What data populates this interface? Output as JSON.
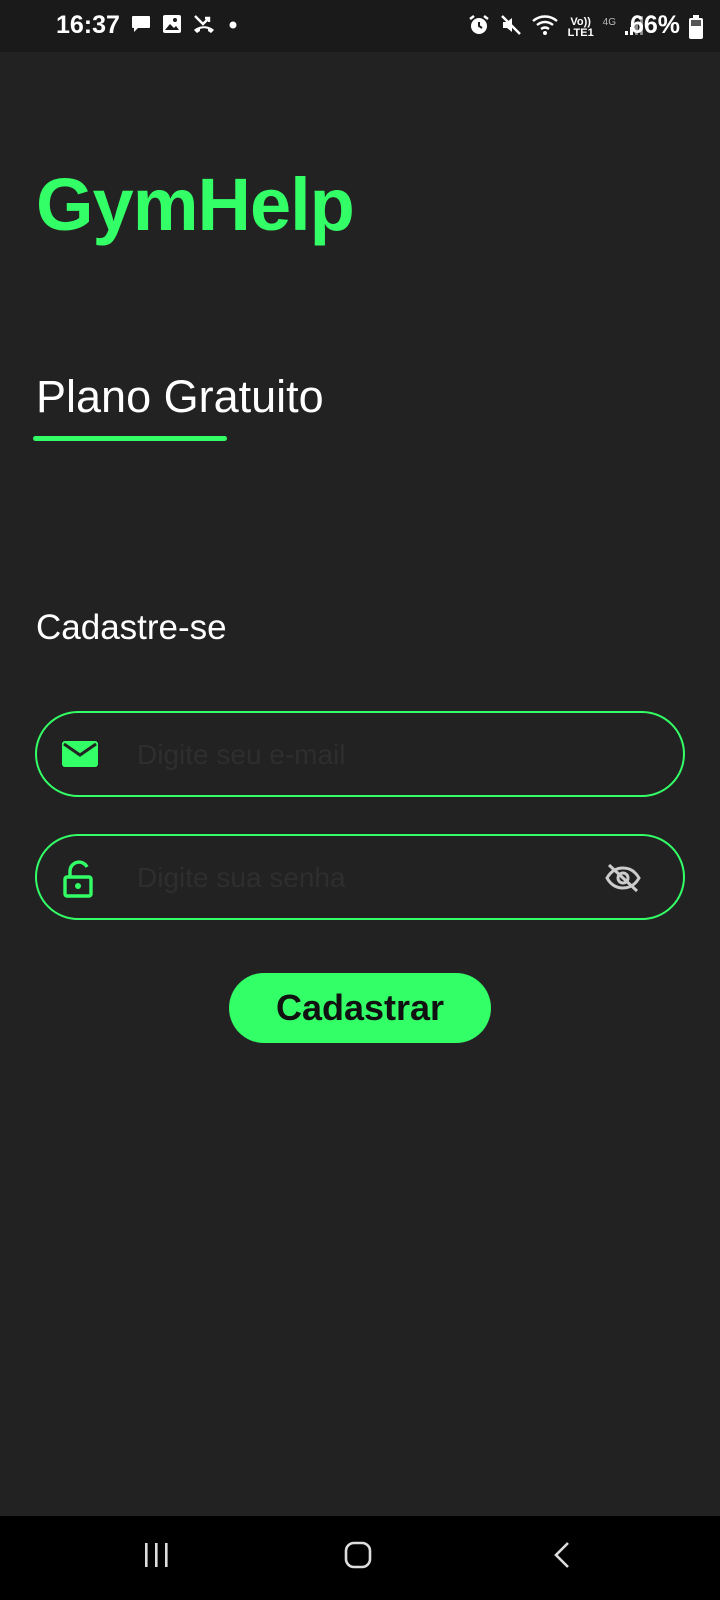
{
  "status_bar": {
    "time": "16:37",
    "battery_percent": "66%",
    "network_lte": "Vo)) LTE1",
    "network_4g": "4G",
    "left_icons": [
      "chat-icon",
      "image-icon",
      "missed-call-icon",
      "dot-icon"
    ],
    "right_icons": [
      "alarm-icon",
      "mute-icon",
      "wifi-icon",
      "lte-icon",
      "signal-icon",
      "battery-icon"
    ]
  },
  "app": {
    "title": "GymHelp",
    "tab_label": "Plano Gratuito",
    "section_title": "Cadastre-se"
  },
  "form": {
    "email_placeholder": "Digite seu e-mail",
    "password_placeholder": "Digite sua senha",
    "submit_label": "Cadastrar"
  },
  "colors": {
    "accent": "#33ff66",
    "background": "#222222",
    "text": "#ffffff"
  },
  "nav_bar": {
    "icons": [
      "recents-icon",
      "home-icon",
      "back-icon"
    ]
  }
}
